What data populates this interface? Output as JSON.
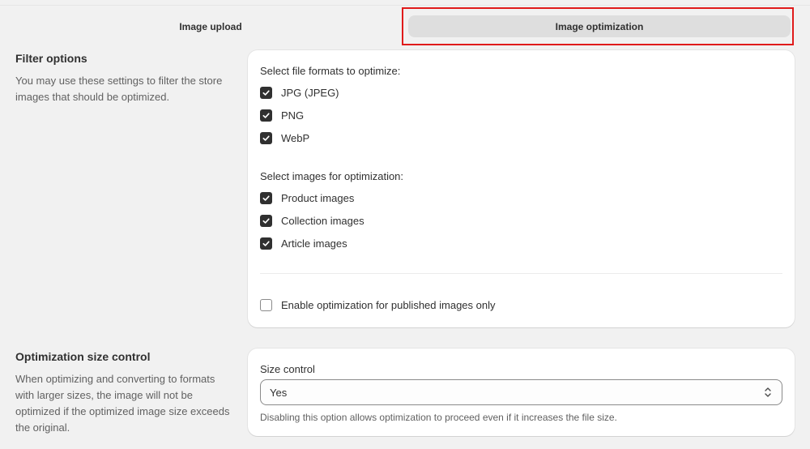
{
  "tabs": [
    {
      "label": "Image upload",
      "active": false
    },
    {
      "label": "Image optimization",
      "active": true
    }
  ],
  "filter_section": {
    "title": "Filter options",
    "description": "You may use these settings to filter the store images that should be optimized.",
    "formats_label": "Select file formats to optimize:",
    "formats": [
      {
        "label": "JPG (JPEG)",
        "checked": true
      },
      {
        "label": "PNG",
        "checked": true
      },
      {
        "label": "WebP",
        "checked": true
      }
    ],
    "images_label": "Select images for optimization:",
    "images": [
      {
        "label": "Product images",
        "checked": true
      },
      {
        "label": "Collection images",
        "checked": true
      },
      {
        "label": "Article images",
        "checked": true
      }
    ],
    "published_only": {
      "label": "Enable optimization for published images only",
      "checked": false
    }
  },
  "size_section": {
    "title": "Optimization size control",
    "description": "When optimizing and converting to formats with larger sizes, the image will not be optimized if the optimized image size exceeds the original.",
    "select_label": "Size control",
    "select_value": "Yes",
    "help_text": "Disabling this option allows optimization to proceed even if it increases the file size."
  },
  "colors": {
    "highlight": "#e01b1b",
    "checkbox": "#303030",
    "active_tab": "#dedede"
  },
  "icons": {
    "checkbox": "check-icon",
    "select": "chevron-up-down-icon"
  }
}
